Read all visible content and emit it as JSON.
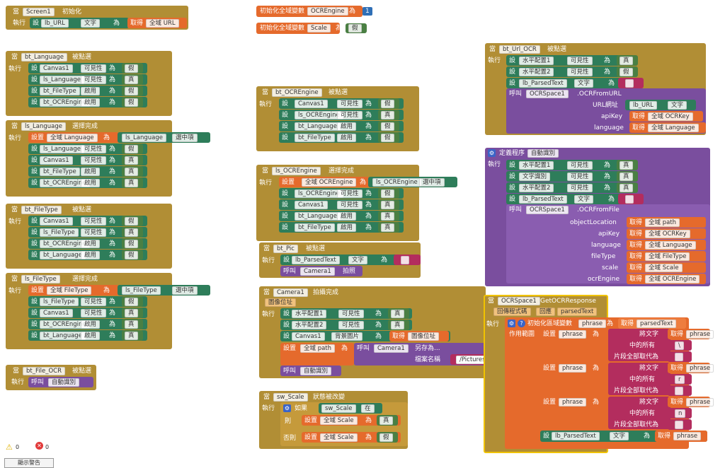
{
  "kw": {
    "when": "當",
    "do": "執行",
    "set": "設",
    "set_global": "設置",
    "to": "為",
    "get": "取得",
    "call": "呼叫",
    "text_prop": "文字",
    "visible": "可見性",
    "enabled": "啟用",
    "true": "真",
    "false": "假",
    "if": "如果",
    "then": "則",
    "else": "否則",
    "initialize_global": "初始化全域變數",
    "selection": "選中項",
    "scope": "作用範圍",
    "initialize_local": "初始化區域變數",
    "replace_text": "將文字",
    "all_in": "中的所有",
    "replace_with": "片段全部取代為"
  },
  "blocks": {
    "screen_init": {
      "comp": "Screen1",
      "event": "初始化",
      "target": "lb_URL",
      "prop": "文字",
      "var": "全域 URL"
    },
    "g_ocrengine": {
      "name": "OCREngine",
      "value": "1"
    },
    "g_scale": {
      "name": "Scale"
    },
    "bt_language": {
      "comp": "bt_Language",
      "event": "被點選",
      "rows": [
        {
          "c": "Canvas1",
          "p": "可見性",
          "v": "假"
        },
        {
          "c": "ls_Language",
          "p": "可見性",
          "v": "真"
        },
        {
          "c": "bt_FileType",
          "p": "啟用",
          "v": "假"
        },
        {
          "c": "bt_OCREngine",
          "p": "啟用",
          "v": "假"
        }
      ]
    },
    "ls_language": {
      "comp": "ls_Language",
      "event": "選擇完成",
      "global": "全域 Language",
      "src": "ls_Language",
      "rows": [
        {
          "c": "ls_Language",
          "p": "可見性",
          "v": "假"
        },
        {
          "c": "Canvas1",
          "p": "可見性",
          "v": "真"
        },
        {
          "c": "bt_FileType",
          "p": "啟用",
          "v": "真"
        },
        {
          "c": "bt_OCREngine",
          "p": "啟用",
          "v": "真"
        }
      ]
    },
    "bt_filetype": {
      "comp": "bt_FileType",
      "event": "被點選",
      "rows": [
        {
          "c": "Canvas1",
          "p": "可見性",
          "v": "假"
        },
        {
          "c": "ls_FileType",
          "p": "可見性",
          "v": "真"
        },
        {
          "c": "bt_OCREngine",
          "p": "啟用",
          "v": "假"
        },
        {
          "c": "bt_Language",
          "p": "啟用",
          "v": "假"
        }
      ]
    },
    "ls_filetype": {
      "comp": "ls_FileType",
      "event": "選擇完成",
      "global": "全域 FileType",
      "src": "ls_FileType",
      "rows": [
        {
          "c": "ls_FileType",
          "p": "可見性",
          "v": "假"
        },
        {
          "c": "Canvas1",
          "p": "可見性",
          "v": "真"
        },
        {
          "c": "bt_OCREngine",
          "p": "啟用",
          "v": "真"
        },
        {
          "c": "bt_Language",
          "p": "啟用",
          "v": "真"
        }
      ]
    },
    "bt_file_ocr": {
      "comp": "bt_File_OCR",
      "event": "被點選",
      "proc": "自動識別"
    },
    "bt_ocrengine": {
      "comp": "bt_OCREngine",
      "event": "被點選",
      "rows": [
        {
          "c": "Canvas1",
          "p": "可見性",
          "v": "假"
        },
        {
          "c": "ls_OCREngine",
          "p": "可見性",
          "v": "真"
        },
        {
          "c": "bt_Language",
          "p": "啟用",
          "v": "假"
        },
        {
          "c": "bt_FileType",
          "p": "啟用",
          "v": "假"
        }
      ]
    },
    "ls_ocrengine": {
      "comp": "ls_OCREngine",
      "event": "選擇完成",
      "global": "全域 OCREngine",
      "src": "ls_OCREngine",
      "rows": [
        {
          "c": "ls_OCREngine",
          "p": "可見性",
          "v": "假"
        },
        {
          "c": "Canvas1",
          "p": "可見性",
          "v": "真"
        },
        {
          "c": "bt_Language",
          "p": "啟用",
          "v": "真"
        },
        {
          "c": "bt_FileType",
          "p": "啟用",
          "v": "真"
        }
      ]
    },
    "bt_pic": {
      "comp": "bt_Pic",
      "event": "被點選",
      "target": "lb_ParsedText",
      "prop": "文字",
      "camera": "Camera1",
      "method": "拍照"
    },
    "camera_after": {
      "comp": "Camera1",
      "event": "拍攝完成",
      "param": "圖像位址",
      "rows": [
        {
          "c": "水平配置1",
          "p": "可見性",
          "v": "真"
        },
        {
          "c": "水平配置2",
          "p": "可見性",
          "v": "真"
        },
        {
          "c": "Canvas1",
          "p": "背景圖片",
          "get": "圖像位址"
        }
      ],
      "global": "全域 path",
      "saveas_comp": "Camera1",
      "saveas": "另存為...",
      "filename_lbl": "檔案名稱",
      "filename": "/Pictures",
      "proc": "自動識別"
    },
    "sw_scale": {
      "comp": "sw_Scale",
      "event": "狀態被改變",
      "cond_comp": "sw_Scale",
      "cond_prop": "在",
      "global": "全域 Scale"
    },
    "bt_url_ocr": {
      "comp": "bt_Url_OCR",
      "event": "被點選",
      "rows": [
        {
          "c": "水平配置1",
          "p": "可見性",
          "v": "真"
        },
        {
          "c": "水平配置2",
          "p": "可見性",
          "v": "假"
        },
        {
          "c": "lb_ParsedText",
          "p": "文字"
        }
      ],
      "call_comp": "OCRSpace1",
      "call_method": ".OCRFromURL",
      "args": [
        {
          "n": "URL網址",
          "c": "lb_URL",
          "p": "文字"
        },
        {
          "n": "apiKey",
          "g": "全域 OCRKey"
        },
        {
          "n": "language",
          "g": "全域 Language"
        }
      ]
    },
    "proc_auto": {
      "keyword": "定義程序",
      "name": "自動識別",
      "rows": [
        {
          "c": "水平配置1",
          "p": "可見性",
          "v": "真"
        },
        {
          "c": "文字識別",
          "p": "可見性",
          "v": "真"
        },
        {
          "c": "水平配置2",
          "p": "可見性",
          "v": "真"
        },
        {
          "c": "lb_ParsedText",
          "p": "文字"
        }
      ],
      "call_comp": "OCRSpace1",
      "call_method": ".OCRFromFile",
      "args": [
        {
          "n": "objectLocation",
          "g": "全域 path"
        },
        {
          "n": "apiKey",
          "g": "全域 OCRKey"
        },
        {
          "n": "language",
          "g": "全域 Language"
        },
        {
          "n": "fileType",
          "g": "全域 FileType"
        },
        {
          "n": "scale",
          "g": "全域 Scale"
        },
        {
          "n": "ocrEngine",
          "g": "全域 OCREngine"
        }
      ]
    },
    "ocr_response": {
      "comp": "OCRSpace1",
      "event": "GetOCRResponse",
      "params": [
        "回傳程式碼",
        "回應",
        "parsedText"
      ],
      "local": "phrase",
      "local_init": "parsedText",
      "replaces": [
        {
          "src": "phrase",
          "find": "\\",
          "with": ""
        },
        {
          "src": "phrase",
          "find": "r",
          "with": ""
        },
        {
          "src": "phrase",
          "find": "n",
          "with": ""
        }
      ],
      "final_comp": "lb_ParsedText",
      "final_prop": "文字",
      "final_get": "phrase"
    }
  },
  "warnings": {
    "warn_count": "0",
    "error_count": "0",
    "toggle": "顯示警告"
  }
}
